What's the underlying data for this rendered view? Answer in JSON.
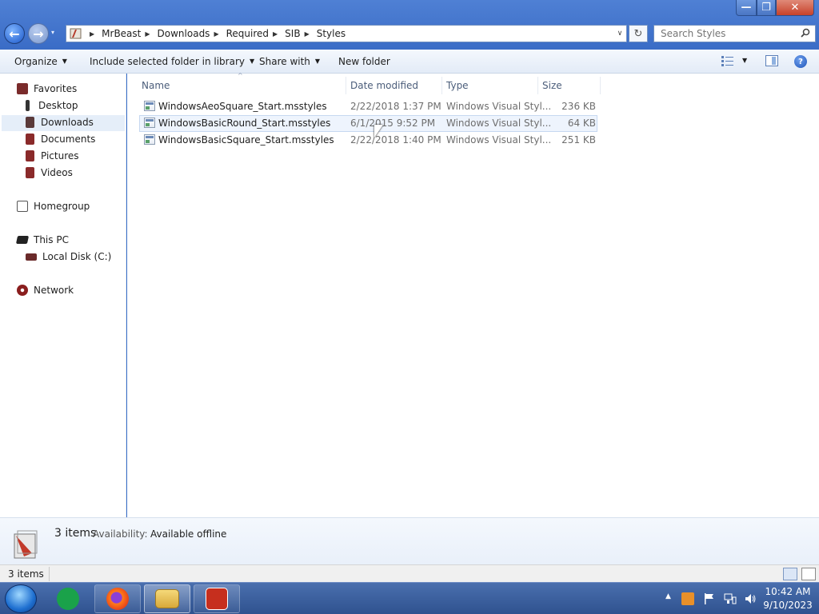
{
  "window": {
    "controls": {
      "minimize": "—",
      "maximize": "❐",
      "close": "✕"
    }
  },
  "nav": {
    "back_glyph": "←",
    "forward_glyph": "→",
    "recent_glyph": "▾",
    "refresh_glyph": "↻"
  },
  "address": {
    "crumbs": [
      "MrBeast",
      "Downloads",
      "Required",
      "SIB",
      "Styles"
    ],
    "dropdown_glyph": "∨"
  },
  "search": {
    "placeholder": "Search Styles"
  },
  "toolbar": {
    "organize": "Organize",
    "include": "Include selected folder in library",
    "share": "Share with",
    "new_folder": "New folder",
    "caret": "▼",
    "help": "?"
  },
  "sidebar": {
    "favorites": "Favorites",
    "desktop": "Desktop",
    "downloads": "Downloads",
    "documents": "Documents",
    "pictures": "Pictures",
    "videos": "Videos",
    "homegroup": "Homegroup",
    "this_pc": "This PC",
    "local_disk": "Local Disk (C:)",
    "network": "Network"
  },
  "columns": {
    "name": "Name",
    "date": "Date modified",
    "type": "Type",
    "size": "Size",
    "sort_glyph": "^"
  },
  "files": [
    {
      "name": "WindowsAeoSquare_Start.msstyles",
      "date": "2/22/2018 1:37 PM",
      "type": "Windows Visual Styl...",
      "size": "236 KB"
    },
    {
      "name": "WindowsBasicRound_Start.msstyles",
      "date": "6/1/2015 9:52 PM",
      "type": "Windows Visual Styl...",
      "size": "64 KB"
    },
    {
      "name": "WindowsBasicSquare_Start.msstyles",
      "date": "2/22/2018 1:40 PM",
      "type": "Windows Visual Styl...",
      "size": "251 KB"
    }
  ],
  "details": {
    "count": "3 items",
    "availability_label": "Availability:",
    "availability_value": "Available offline"
  },
  "status": {
    "text": "3 items"
  },
  "taskbar": {
    "tray_arrow": "▲",
    "time": "10:42 AM",
    "date": "9/10/2023"
  },
  "colors": {
    "titlebar": "#3a6cc6",
    "toolbar": "#e3ebf7",
    "hover_row": "#eef4fd",
    "selected_nav": "#e5eef9",
    "taskbar": "#2f528f"
  }
}
